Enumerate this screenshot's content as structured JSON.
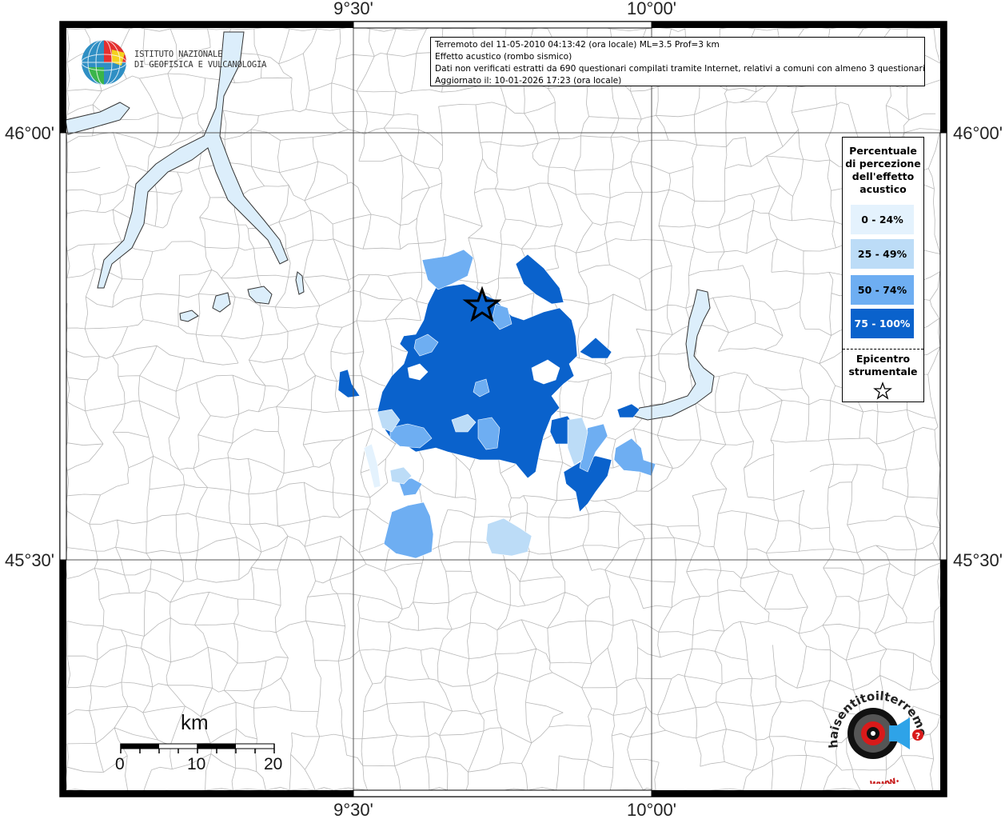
{
  "header": {
    "line1": "Terremoto del 11-05-2010 04:13:42 (ora locale) ML=3.5 Prof=3 km",
    "line2": "Effetto acustico (rombo sismico)",
    "line3": "Dati non verificati estratti da 690 questionari compilati tramite Internet, relativi a comuni con almeno 3 questionari.",
    "line4": "Aggiornato il: 10-01-2026 17:23 (ora locale)"
  },
  "institute": {
    "line1": "ISTITUTO NAZIONALE",
    "line2": "DI GEOFISICA E VULCANOLOGIA"
  },
  "axes": {
    "lon_top_1": "9°30'",
    "lon_top_2": "10°00'",
    "lon_bottom_1": "9°30'",
    "lon_bottom_2": "10°00'",
    "lat_left_1": "46°00'",
    "lat_left_2": "45°30'",
    "lat_right_1": "46°00'",
    "lat_right_2": "45°30'"
  },
  "legend": {
    "title_lines": [
      "Percentuale",
      "di percezione",
      "dell'effetto",
      "acustico"
    ],
    "classes": [
      {
        "label": "0 - 24%",
        "color": "#e4f2fd"
      },
      {
        "label": "25 - 49%",
        "color": "#bcdcf7"
      },
      {
        "label": "50 - 74%",
        "color": "#6eaef2"
      },
      {
        "label": "75 - 100%",
        "color": "#0a62cc"
      }
    ],
    "epicenter_lines": [
      "Epicentro",
      "strumentale"
    ]
  },
  "scale": {
    "unit": "km",
    "ticks": [
      "0",
      "10",
      "20"
    ]
  },
  "colors": {
    "water": "#dceefb",
    "border_line": "#b0b0b0",
    "frame": "#000000"
  },
  "logo_hai": {
    "text": "haisentitoilterremoto.it",
    "url": "www."
  }
}
